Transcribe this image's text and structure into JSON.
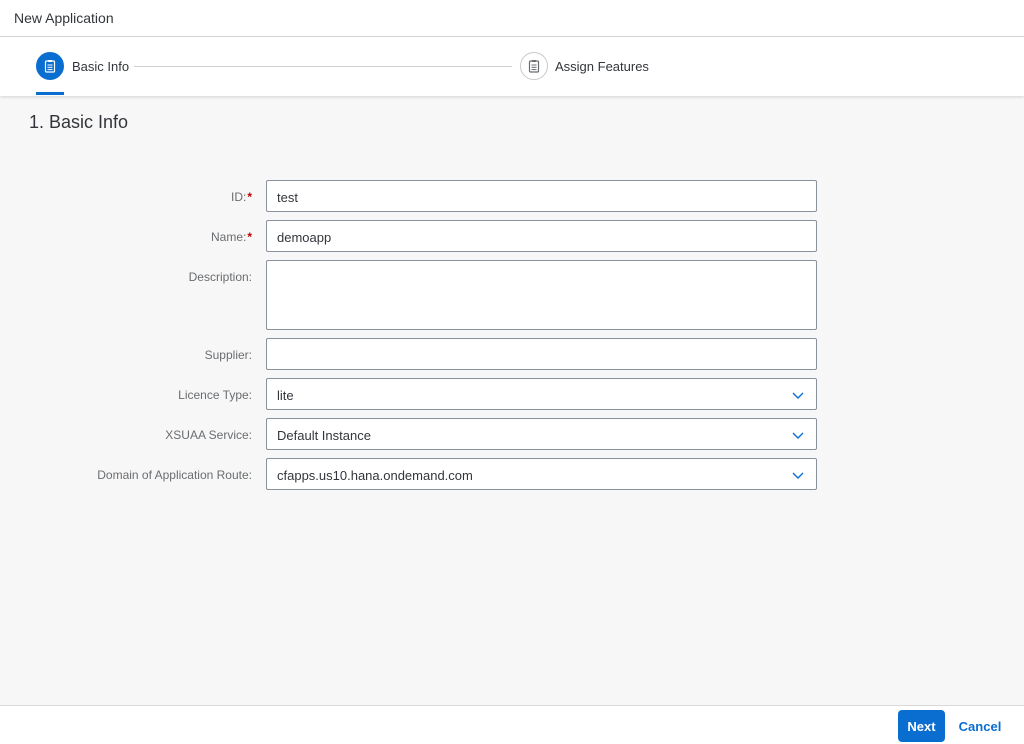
{
  "window": {
    "title": "New Application"
  },
  "wizard": {
    "steps": [
      {
        "label": "Basic Info",
        "icon": "clipboard-icon",
        "state": "active"
      },
      {
        "label": "Assign Features",
        "icon": "clipboard-icon",
        "state": "inactive"
      }
    ]
  },
  "section": {
    "title": "1. Basic Info"
  },
  "form": {
    "id": {
      "label": "ID:",
      "required": "*",
      "value": "test"
    },
    "name": {
      "label": "Name:",
      "required": "*",
      "value": "demoapp"
    },
    "description": {
      "label": "Description:",
      "value": ""
    },
    "supplier": {
      "label": "Supplier:",
      "value": ""
    },
    "licence_type": {
      "label": "Licence Type:",
      "value": "lite"
    },
    "xsuaa_service": {
      "label": "XSUAA Service:",
      "value": "Default Instance"
    },
    "domain_route": {
      "label": "Domain of Application Route:",
      "value": "cfapps.us10.hana.ondemand.com"
    }
  },
  "footer": {
    "next_label": "Next",
    "cancel_label": "Cancel"
  },
  "colors": {
    "accent": "#0a6ed1",
    "required": "#bb0000",
    "background": "#f7f7f7"
  }
}
